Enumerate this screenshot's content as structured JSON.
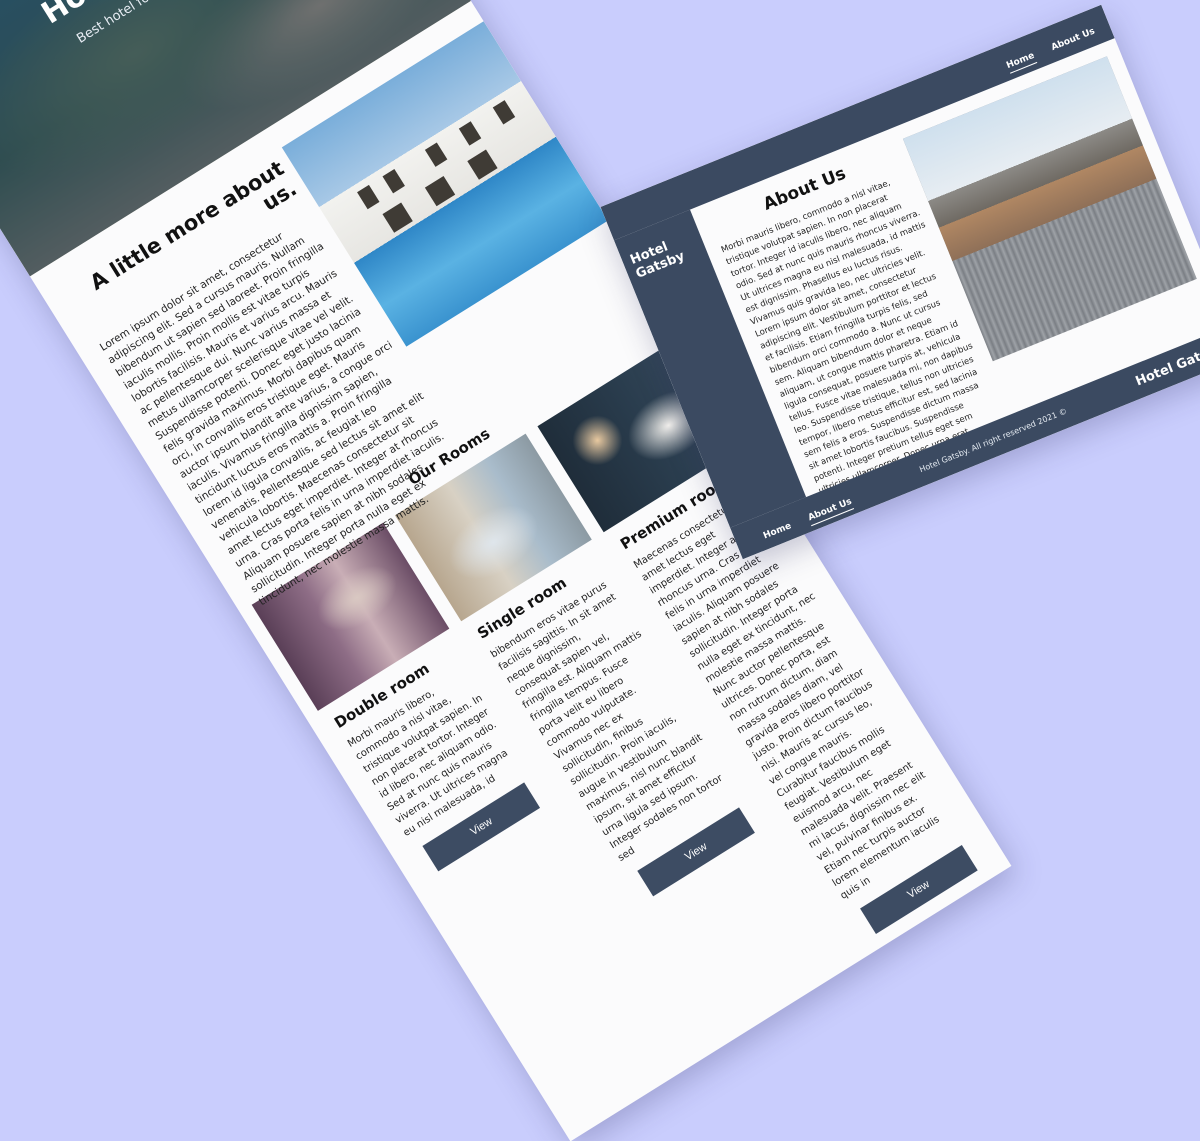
{
  "left": {
    "hero": {
      "title": "Hotel Gatsby",
      "subtitle": "Best hotel for your vacations"
    },
    "about": {
      "heading": "A little more about us.",
      "text": "Lorem ipsum dolor sit amet, consectetur adipiscing elit. Sed a cursus mauris. Nullam bibendum ut sapien sed laoreet. Proin fringilla iaculis mollis. Proin mollis est vitae turpis lobortis facilisis. Mauris et varius arcu. Mauris ac pellentesque dui. Nunc varius massa et metus ullamcorper scelerisque vitae vel velit. Suspendisse potenti. Donec eget justo lacinia felis gravida maximus. Morbi dapibus quam orci, in convallis eros tristique eget. Mauris auctor ipsum blandit ante varius, a congue orci iaculis. Vivamus fringilla dignissim sapien, tincidunt luctus eros mattis a. Proin fringilla lorem id ligula convallis, ac feugiat leo venenatis. Pellentesque sed lectus sit amet elit vehicula lobortis. Maecenas consectetur sit amet lectus eget imperdiet. Integer at rhoncus urna. Cras porta felis in urna imperdiet iaculis. Aliquam posuere sapien at nibh sodales sollicitudin. Integer porta nulla eget ex tincidunt, nec molestie massa mattis."
    },
    "rooms_title": "Our Rooms",
    "rooms": [
      {
        "name": "Double room",
        "text": "Morbi mauris libero, commodo a nisl vitae, tristique volutpat sapien. In non placerat tortor. Integer id libero, nec aliquam odio. Sed at nunc quis mauris viverra. Ut ultrices magna eu nisl malesuada, id"
      },
      {
        "name": "Single room",
        "text": "bibendum eros vitae purus facilisis sagittis. In sit amet neque dignissim, consequat sapien vel, fringilla est. Aliquam mattis fringilla tempus. Fusce porta velit eu libero commodo vulputate. Vivamus nec ex sollicitudin, finibus sollicitudin. Proin iaculis, augue in vestibulum maximus, nisl nunc blandit ipsum, sit amet efficitur urna ligula sed ipsum. Integer sodales non tortor sed"
      },
      {
        "name": "Premium room",
        "text": "Maecenas consectetur sit amet lectus eget imperdiet. Integer at rhoncus urna. Cras porta felis in urna imperdiet iaculis. Aliquam posuere sapien at nibh sodales sollicitudin. Integer porta nulla eget ex tincidunt, nec molestie massa mattis. Nunc auctor pellentesque ultrices. Donec porta, est non rutrum dictum, diam massa sodales diam, vel gravida eros libero porttitor justo. Proin dictum faucibus nisi. Mauris ac cursus leo, vel congue mauris. Curabitur faucibus mollis feugiat. Vestibulum eget euismod arcu, nec malesuada velit. Praesent mi lacus, dignissim nec elit vel, pulvinar finibus ex. Etiam nec turpis auctor lorem elementum iaculis quis in"
      }
    ],
    "button_label": "View"
  },
  "right": {
    "nav": {
      "home": "Home",
      "about": "About Us"
    },
    "side_title": "Hotel Gatsby",
    "about_title": "About Us",
    "about_text": "Morbi mauris libero, commodo a nisl vitae, tristique volutpat sapien. In non placerat tortor. Integer id iaculis libero, nec aliquam odio. Sed at nunc quis mauris rhoncus viverra. Ut ultrices magna eu nisl malesuada, id mattis est dignissim. Phasellus eu luctus risus. Vivamus quis gravida leo, nec ultricies velit. Lorem ipsum dolor sit amet, consectetur adipiscing elit. Vestibulum porttitor et lectus et facilisis. Etiam fringilla turpis felis, sed bibendum orci commodo a. Nunc ut cursus sem. Aliquam bibendum dolor et neque aliquam, ut congue mattis pharetra. Etiam id ligula consequat, posuere turpis at, vehicula tellus. Fusce vitae malesuada mi, non dapibus leo. Suspendisse tristique, tellus non ultricies tempor, libero metus efficitur est, sed lacinia sem felis a eros. Suspendisse dictum massa sit amet lobortis faucibus. Suspendisse potenti. Integer pretium tellus eget sem ultricies ullamcorper. Donec urna erat, pulvinar non ullamcorper non, fermentum vel velit.",
    "bottom_title": "Hotel Gatsby",
    "copyright": "Hotel Gatsby. All right reserved 2021 ©",
    "bottom_nav": {
      "home": "Home",
      "about": "About Us"
    }
  },
  "colors": {
    "background": "#c9cdfd",
    "navy": "#3b4a61",
    "page": "#fbfbfc"
  }
}
